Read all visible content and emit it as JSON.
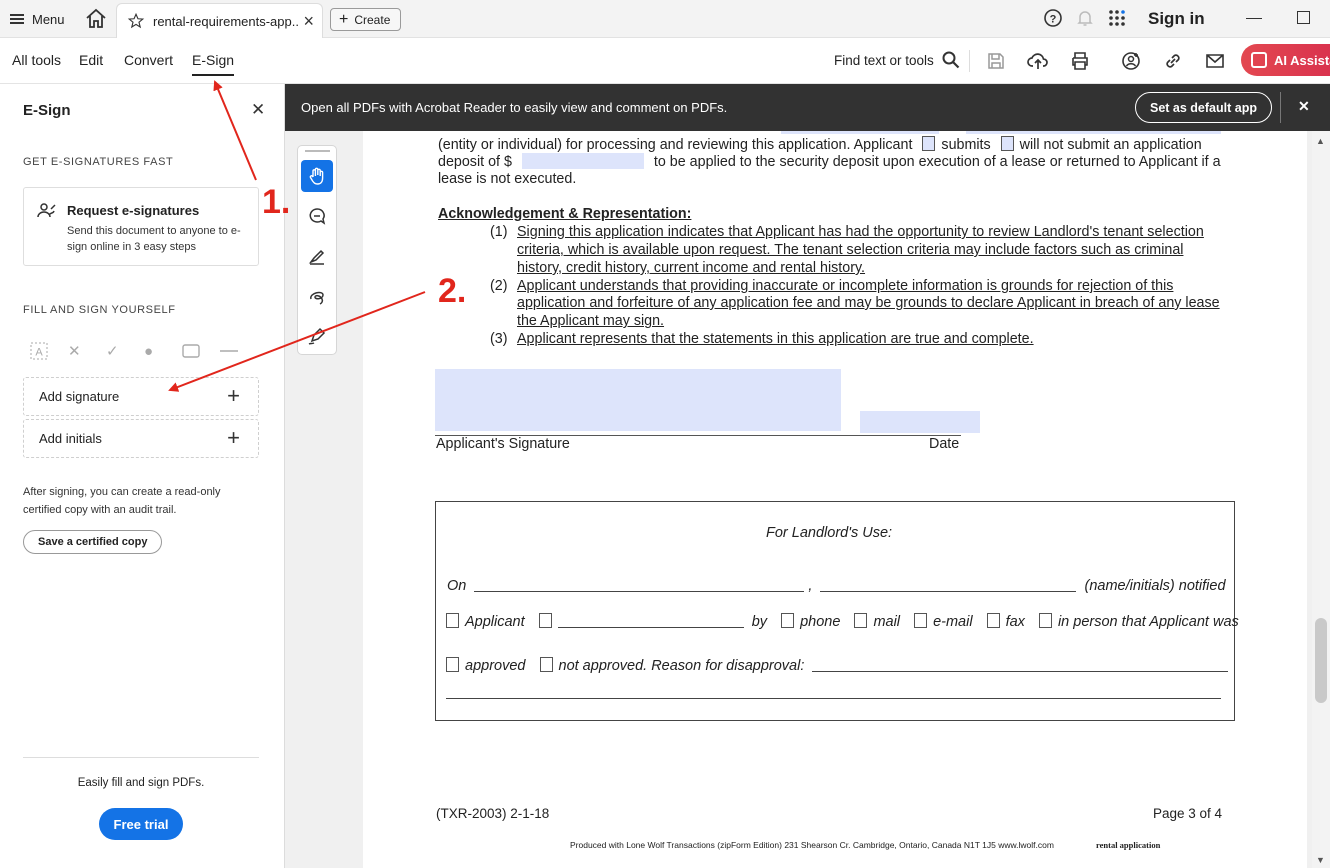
{
  "titlebar": {
    "menu_label": "Menu",
    "tab_label": "rental-requirements-app...",
    "create_label": "Create",
    "signin_label": "Sign in"
  },
  "toolbar": {
    "nav": [
      "All tools",
      "Edit",
      "Convert",
      "E-Sign"
    ],
    "active_nav": "E-Sign",
    "find_label": "Find text or tools",
    "ai_label": "AI Assista",
    "accent_color": "#e34850"
  },
  "panel": {
    "title": "E-Sign",
    "section_fast": "GET E-SIGNATURES FAST",
    "request_title": "Request e-signatures",
    "request_desc": "Send this document to anyone to e-sign online in 3 easy steps",
    "section_fill": "FILL AND SIGN YOURSELF",
    "tool_icons": [
      "text-field-icon",
      "cross-icon",
      "checkmark-icon",
      "dot-icon",
      "rectangle-icon",
      "line-icon"
    ],
    "add_signature": "Add signature",
    "add_initials": "Add initials",
    "after_text": "After signing, you can create a read-only certified copy with an audit trail.",
    "certified_btn": "Save a certified copy",
    "easily_text": "Easily fill and sign PDFs.",
    "free_trial": "Free trial",
    "primary_color": "#1473e6"
  },
  "banner": {
    "text": "Open all PDFs with Acrobat Reader to easily view and comment on PDFs.",
    "default_btn": "Set as default app"
  },
  "document": {
    "line1a": "(entity or individual) for processing and reviewing this application.  Applicant",
    "line1b": "submits",
    "line1c": "will not submit an application",
    "line2a": "deposit of $",
    "line2b": "to be applied to the security deposit upon execution of a lease or returned to Applicant if a",
    "line3": "lease is not executed.",
    "ack_heading": "Acknowledgement & Representation:",
    "item1_num": "(1)",
    "item1": [
      "Signing this application indicates that Applicant has had the opportunity to review Landlord's tenant selection",
      "criteria, which is available upon request. The tenant selection criteria may include factors such as criminal",
      "history, credit history, current income and rental history."
    ],
    "item2_num": "(2)",
    "item2": [
      "Applicant understands that providing inaccurate or incomplete information is grounds for rejection of this",
      "application and forfeiture of any application fee and may be grounds to declare Applicant in breach of any lease",
      "the Applicant may sign."
    ],
    "item3_num": "(3)",
    "item3": "Applicant represents that the statements in this application are true and complete.",
    "applicant_sig": "Applicant's Signature",
    "date_label": "Date",
    "landlord_title": "For Landlord's Use:",
    "ll_on": "On",
    "ll_notified": "(name/initials) notified",
    "ll_applicant": "Applicant",
    "ll_by": "by",
    "ll_phone": "phone",
    "ll_mail": "mail",
    "ll_email": "e-mail",
    "ll_fax": "fax",
    "ll_person": "in person that Applicant was",
    "ll_approved": "approved",
    "ll_not_approved": "not approved.  Reason for disapproval:",
    "footer_left": "(TXR-2003) 2-1-18",
    "footer_right": "Page 3 of 4",
    "produced": "Produced with Lone Wolf Transactions (zipForm Edition) 231 Shearson Cr. Cambridge, Ontario, Canada N1T 1J5    www.lwolf.com",
    "produced_name": "rental application",
    "fill_color": "#dde4fb"
  },
  "annotations": {
    "step1": "1.",
    "step2": "2.",
    "color": "#e1261c"
  }
}
